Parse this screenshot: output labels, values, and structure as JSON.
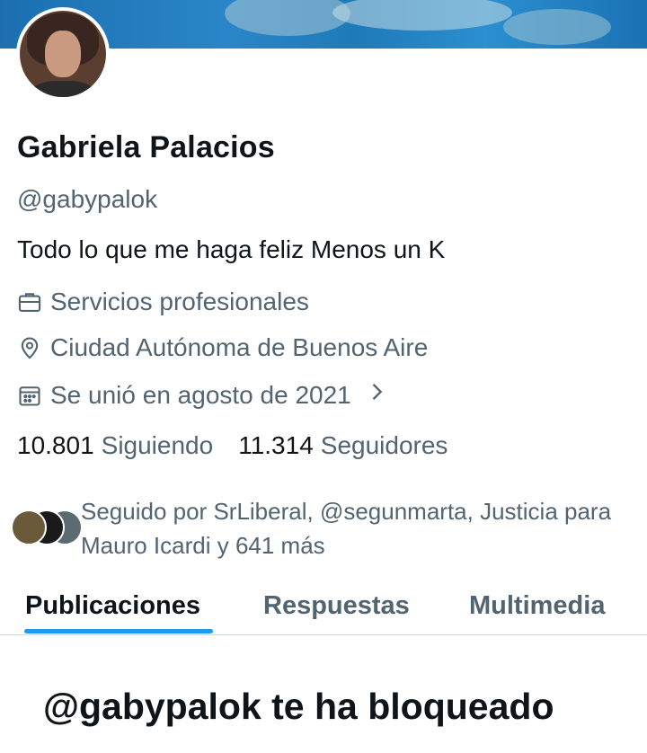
{
  "profile": {
    "name": "Gabriela Palacios",
    "handle": "@gabypalok",
    "bio": "Todo lo que me haga feliz Menos un K",
    "category": "Servicios profesionales",
    "location": "Ciudad Autónoma de Buenos Aire",
    "joined": "Se unió en agosto de 2021",
    "following_count": "10.801",
    "following_label": "Siguiendo",
    "followers_count": "11.314",
    "followers_label": "Seguidores",
    "followed_by": "Seguido por SrLiberal, @segunmarta, Justicia para Mauro Icardi y 641 más"
  },
  "tabs": [
    {
      "label": "Publicaciones",
      "active": true
    },
    {
      "label": "Respuestas",
      "active": false
    },
    {
      "label": "Multimedia",
      "active": false
    }
  ],
  "blocked_message": "@gabypalok te ha bloqueado",
  "icons": {
    "category": "briefcase-icon",
    "location": "location-pin-icon",
    "joined": "calendar-icon",
    "joined_more": "chevron-right-icon"
  },
  "colors": {
    "accent": "#1d9bf0",
    "text_primary": "#0f1419",
    "text_secondary": "#536471"
  }
}
